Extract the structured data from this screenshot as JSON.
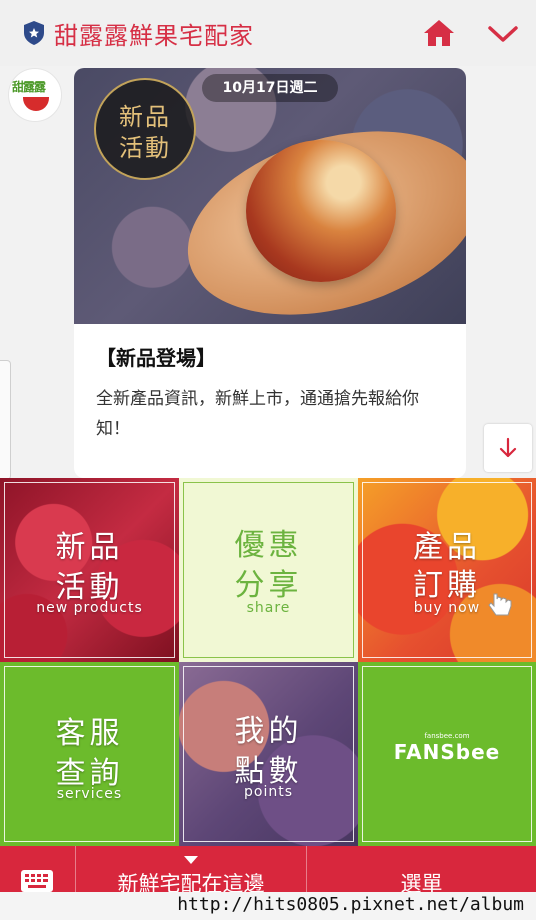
{
  "header": {
    "title": "甜露露鮮果宅配家"
  },
  "avatar": {
    "logo_text": "甜露露"
  },
  "message_card": {
    "date": "10月17日週二",
    "badge_line1": "新品",
    "badge_line2": "活動",
    "title": "【新品登場】",
    "body": "全新產品資訊，新鮮上市，通通搶先報給你知！"
  },
  "rich_menu": [
    {
      "label_line1": "新品",
      "label_line2": "活動",
      "sublabel": "new products"
    },
    {
      "label_line1": "優惠",
      "label_line2": "分享",
      "sublabel": "share"
    },
    {
      "label_line1": "產品",
      "label_line2": "訂購",
      "sublabel": "buy now"
    },
    {
      "label_line1": "客服",
      "label_line2": "查詢",
      "sublabel": "services"
    },
    {
      "label_line1": "我的",
      "label_line2": "點數",
      "sublabel": "points"
    },
    {
      "logo_top": "fansbee.com",
      "logo_main": "FANSbee"
    }
  ],
  "bottom_bar": {
    "menu_title": "新鮮宅配在這邊",
    "menu_button": "選單"
  },
  "watermark": "http://hits0805.pixnet.net/album",
  "colors": {
    "brand_red": "#d8273d",
    "brand_green": "#6cbb2c",
    "title_red": "#d62f45"
  },
  "icons": [
    "shield-icon",
    "home-icon",
    "chevron-down-icon",
    "arrow-down-icon",
    "keyboard-icon",
    "hand-pointer-icon"
  ]
}
